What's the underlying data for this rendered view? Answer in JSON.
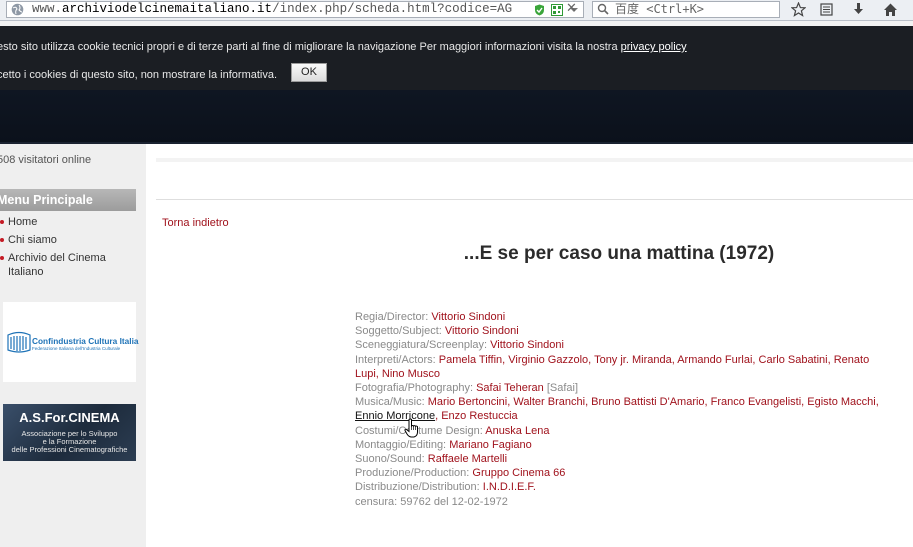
{
  "browser": {
    "url_prefix": "www.",
    "url_domain": "archiviodelcinemaitaliano.it",
    "url_path": "/index.php/scheda.html?codice=AG",
    "search_placeholder": "百度 <Ctrl+K>"
  },
  "cookie": {
    "line1": "esto sito utilizza cookie tecnici propri e di terze parti al fine di migliorare la navigazione Per maggiori informazioni visita la nostra",
    "privacy_link": "privacy policy",
    "line2": "cetto i cookies di questo sito, non mostrare la informativa.",
    "ok_label": "OK"
  },
  "sidebar": {
    "visitors": "508 visitatori online",
    "menu_title": "Menu Principale",
    "items": [
      {
        "label": "Home"
      },
      {
        "label": "Chi siamo"
      },
      {
        "label": "Archivio del Cinema Italiano"
      }
    ],
    "banner1_title": "Confindustria Cultura Italia",
    "banner1_sub": "Federazione Italiana dell'Industria Culturale",
    "banner2_title": "A.S.For.CINEMA",
    "banner2_lines": [
      "Associazione per lo Sviluppo",
      "e la Formazione",
      "delle Professioni Cinematografiche"
    ]
  },
  "main": {
    "back_link": "Torna indietro",
    "title": "...E se per caso una mattina (1972)",
    "credits": {
      "director_label": "Regia/Director:",
      "director": "Vittorio Sindoni",
      "subject_label": "Soggetto/Subject:",
      "subject": "Vittorio Sindoni",
      "screenplay_label": "Sceneggiatura/Screenplay:",
      "screenplay": "Vittorio Sindoni",
      "actors_label": "Interpreti/Actors:",
      "actors_line1": "Pamela Tiffin, Virginio Gazzolo, Tony jr. Miranda, Armando Furlai, Carlo Sabatini, Renato",
      "actors_line2": "Lupi, Nino Musco",
      "photo_label": "Fotografia/Photography:",
      "photo": "Safai Teheran",
      "photo_note": "[Safai]",
      "music_label": "Musica/Music:",
      "music_line1": "Mario Bertoncini, Walter Branchi, Bruno Battisti D'Amario, Franco Evangelisti, Egisto Macchi,",
      "music_hover": "Ennio Morricone",
      "music_line2_rest": ", Enzo Restuccia",
      "costume_label": "Costumi/Costume Design:",
      "costume": "Anuska Lena",
      "editing_label": "Montaggio/Editing:",
      "editing": "Mariano Fagiano",
      "sound_label": "Suono/Sound:",
      "sound": "Raffaele Martelli",
      "production_label": "Produzione/Production:",
      "production": "Gruppo Cinema 66",
      "distribution_label": "Distribuzione/Distribution:",
      "distribution": "I.N.D.I.E.F.",
      "censorship_label": "censura:",
      "censorship": "59762 del 12-02-1972"
    }
  }
}
